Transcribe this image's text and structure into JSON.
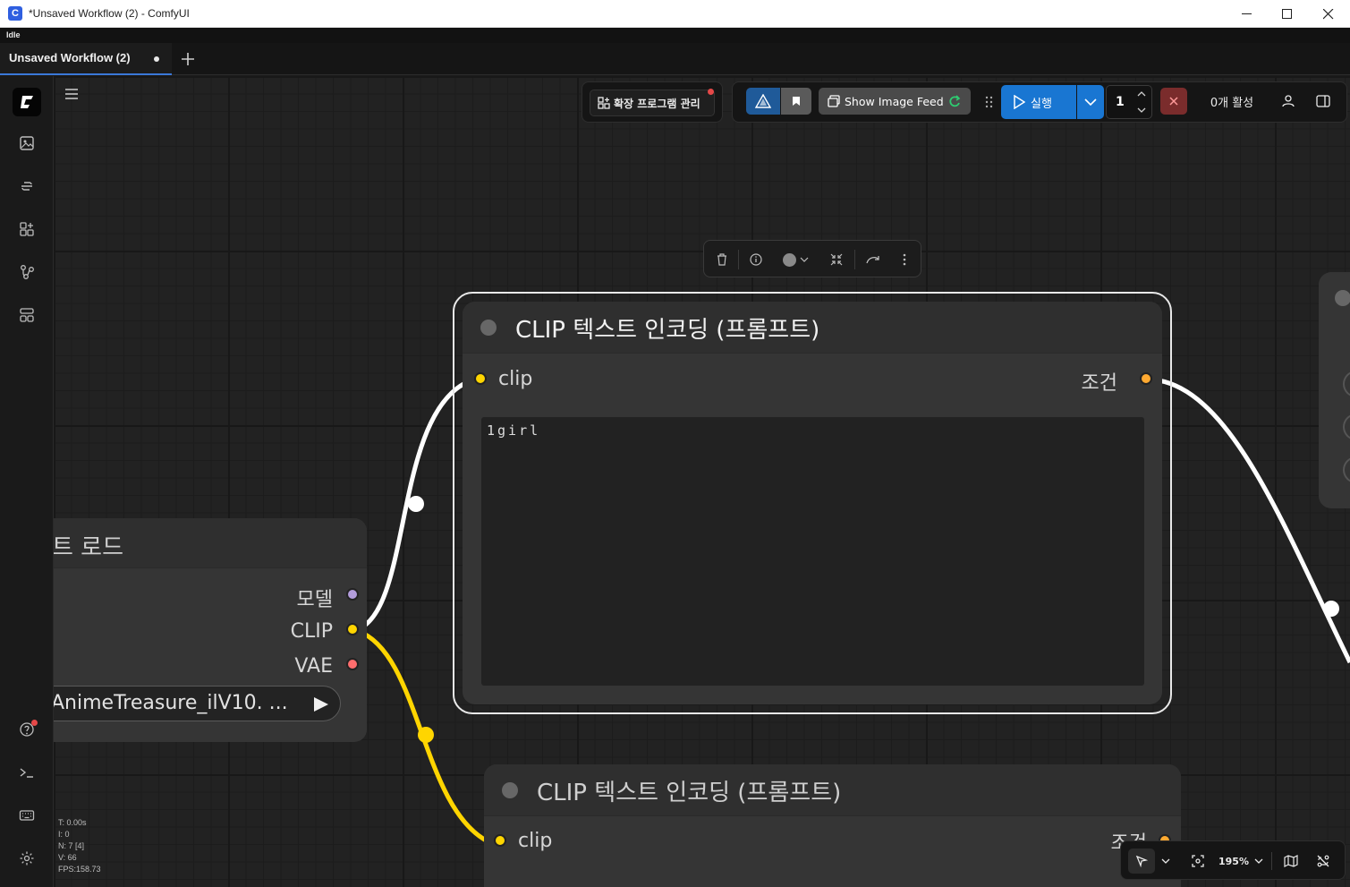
{
  "window": {
    "title": "*Unsaved Workflow (2) - ComfyUI",
    "minimize_glyph": "—",
    "maximize_glyph": "☐",
    "close_glyph": "✕"
  },
  "status": {
    "text": "Idle"
  },
  "tabs": [
    {
      "label": "Unsaved Workflow (2)",
      "unsaved": true
    }
  ],
  "toolbar": {
    "extensions_label": "확장 프로그램 관리",
    "show_image_feed_label": "Show Image Feed",
    "run_label": "실행",
    "batch_count": "1",
    "active_label": "0개 활성"
  },
  "node_toolbar": {
    "icons": [
      "trash-icon",
      "info-icon",
      "color-picker",
      "collapse-icon",
      "bypass-icon",
      "more-icon"
    ]
  },
  "nodes": {
    "checkpoint_loader": {
      "title_partial": "트 로드",
      "outputs": [
        "모델",
        "CLIP",
        "VAE"
      ],
      "output_colors": [
        "#b39ddb",
        "#ffd500",
        "#ff6e6e"
      ],
      "ckpt_value": "AnimeTreasure_ilV10. ..."
    },
    "clip_text_encode_1": {
      "title": "CLIP 텍스트 인코딩 (프롬프트)",
      "input": "clip",
      "output": "조건",
      "text": "1girl",
      "input_color": "#ffd500",
      "output_color": "#ffa931"
    },
    "clip_text_encode_2": {
      "title": "CLIP 텍스트 인코딩 (프롬프트)",
      "input": "clip",
      "output_partial": "조건"
    }
  },
  "stats": {
    "t": "T: 0.00s",
    "i": "I: 0",
    "n": "N: 7 [4]",
    "v": "V: 66",
    "fps": "FPS:158.73"
  },
  "canvas_controls": {
    "zoom": "195%"
  },
  "colors": {
    "accent": "#3a78d8",
    "run_button": "#1976d2",
    "cancel_button": "#7a2c2c",
    "clip_link": "#ffd500",
    "selected_link": "#ffffff"
  }
}
